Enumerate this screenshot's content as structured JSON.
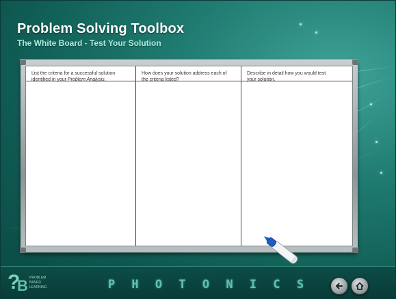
{
  "header": {
    "title": "Problem Solving Toolbox",
    "subtitle": "The White Board - Test Your Solution"
  },
  "whiteboard": {
    "columns": [
      {
        "line1": "List the criteria for a successful solution",
        "line2_prefix": "identified in your ",
        "line2_emphasis": "Problem Analysis",
        "line2_suffix": "."
      },
      {
        "line1": "How does your solution address each of",
        "line2_prefix": "the criteria listed?",
        "line2_emphasis": "",
        "line2_suffix": ""
      },
      {
        "line1": "Describe in detail how  you would test",
        "line2_prefix": "your solution.",
        "line2_emphasis": "",
        "line2_suffix": ""
      }
    ]
  },
  "footer": {
    "logo": {
      "words": [
        "PROBLEM",
        "BASED",
        "LEARNING"
      ],
      "icon": "question-mark-pbl-logo"
    },
    "brand_letters": [
      "P",
      "H",
      "O",
      "T",
      "O",
      "N",
      "I",
      "C",
      "S"
    ],
    "nav": {
      "back_icon": "back-arrow-icon",
      "home_icon": "home-icon"
    }
  },
  "colors": {
    "background": "#1f7a70",
    "title": "#ffffff",
    "subtitle": "#a8f0dc",
    "brand_letters": "#5ec3ad"
  }
}
